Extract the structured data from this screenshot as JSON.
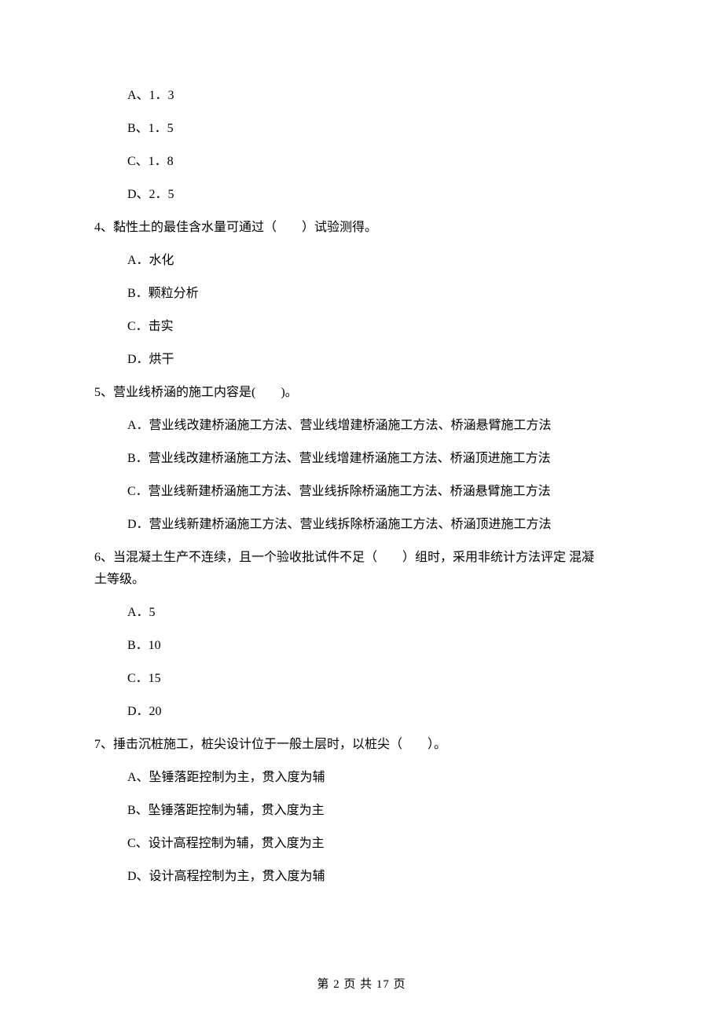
{
  "q3": {
    "opts": {
      "a": "A、1．3",
      "b": "B、1．5",
      "c": "C、1．8",
      "d": "D、2．5"
    }
  },
  "q4": {
    "stem": "4、黏性土的最佳含水量可通过（　　）试验测得。",
    "opts": {
      "a": "A．水化",
      "b": "B．颗粒分析",
      "c": "C．击实",
      "d": "D．烘干"
    }
  },
  "q5": {
    "stem": "5、营业线桥涵的施工内容是(　　)。",
    "opts": {
      "a": "A．营业线改建桥涵施工方法、营业线增建桥涵施工方法、桥涵悬臂施工方法",
      "b": "B．营业线改建桥涵施工方法、营业线增建桥涵施工方法、桥涵顶进施工方法",
      "c": "C．营业线新建桥涵施工方法、营业线拆除桥涵施工方法、桥涵悬臂施工方法",
      "d": "D．营业线新建桥涵施工方法、营业线拆除桥涵施工方法、桥涵顶进施工方法"
    }
  },
  "q6": {
    "stem_part1": "6、当混凝土生产不连续，且一个验收批试件不足（　　）组时，采用非统计方法评定 混凝",
    "stem_part2": "土等级。",
    "opts": {
      "a": "A．5",
      "b": "B．10",
      "c": "C．15",
      "d": "D．20"
    }
  },
  "q7": {
    "stem": "7、捶击沉桩施工，桩尖设计位于一般土层时，以桩尖（　　）。",
    "opts": {
      "a": "A、坠锤落距控制为主，贯入度为辅",
      "b": "B、坠锤落距控制为辅，贯入度为主",
      "c": "C、设计高程控制为辅，贯入度为主",
      "d": "D、设计高程控制为主，贯入度为辅"
    }
  },
  "footer": "第 2 页 共 17 页"
}
